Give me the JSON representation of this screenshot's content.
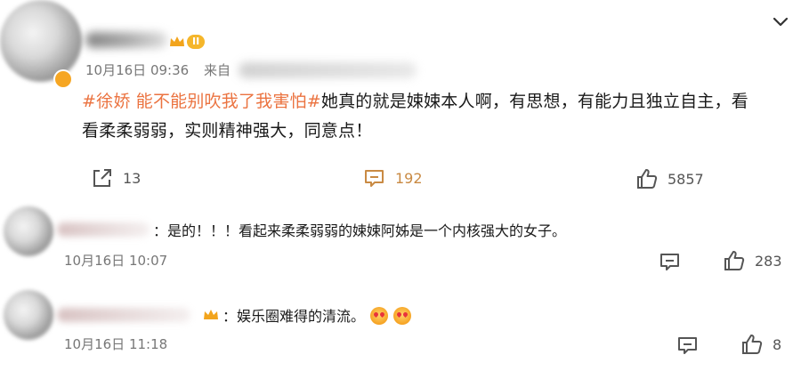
{
  "post": {
    "level_badge": "II",
    "date_time": "10月16日 09:36",
    "source_label": "来自",
    "hashtag": "#徐娇 能不能别吹我了我害怕#",
    "text": "她真的就是娕娕本人啊，有思想，有能力且独立自主，看",
    "text_line2": "看柔柔弱弱，实则精神强大，同意点！",
    "reposts": "13",
    "comments": "192",
    "likes": "5857"
  },
  "comments": [
    {
      "separator": "：",
      "text": "是的！！！看起来柔柔弱弱的娕娕阿姊是一个内核强大的女子。",
      "date_time": "10月16日 10:07",
      "likes": "283"
    },
    {
      "separator": "：",
      "text": "娱乐圈难得的清流。",
      "date_time": "10月16日 11:18",
      "likes": "8"
    }
  ],
  "icons": {
    "collapse": "chevron-down-icon",
    "repost": "share-icon",
    "comment": "comment-icon",
    "like": "thumbs-up-icon",
    "crown": "crown-icon",
    "emoji": "heart-eyes-emoji-icon"
  },
  "colors": {
    "hashtag": "#eb7340",
    "vip_gold": "#f5b62a",
    "muted": "#777777"
  }
}
